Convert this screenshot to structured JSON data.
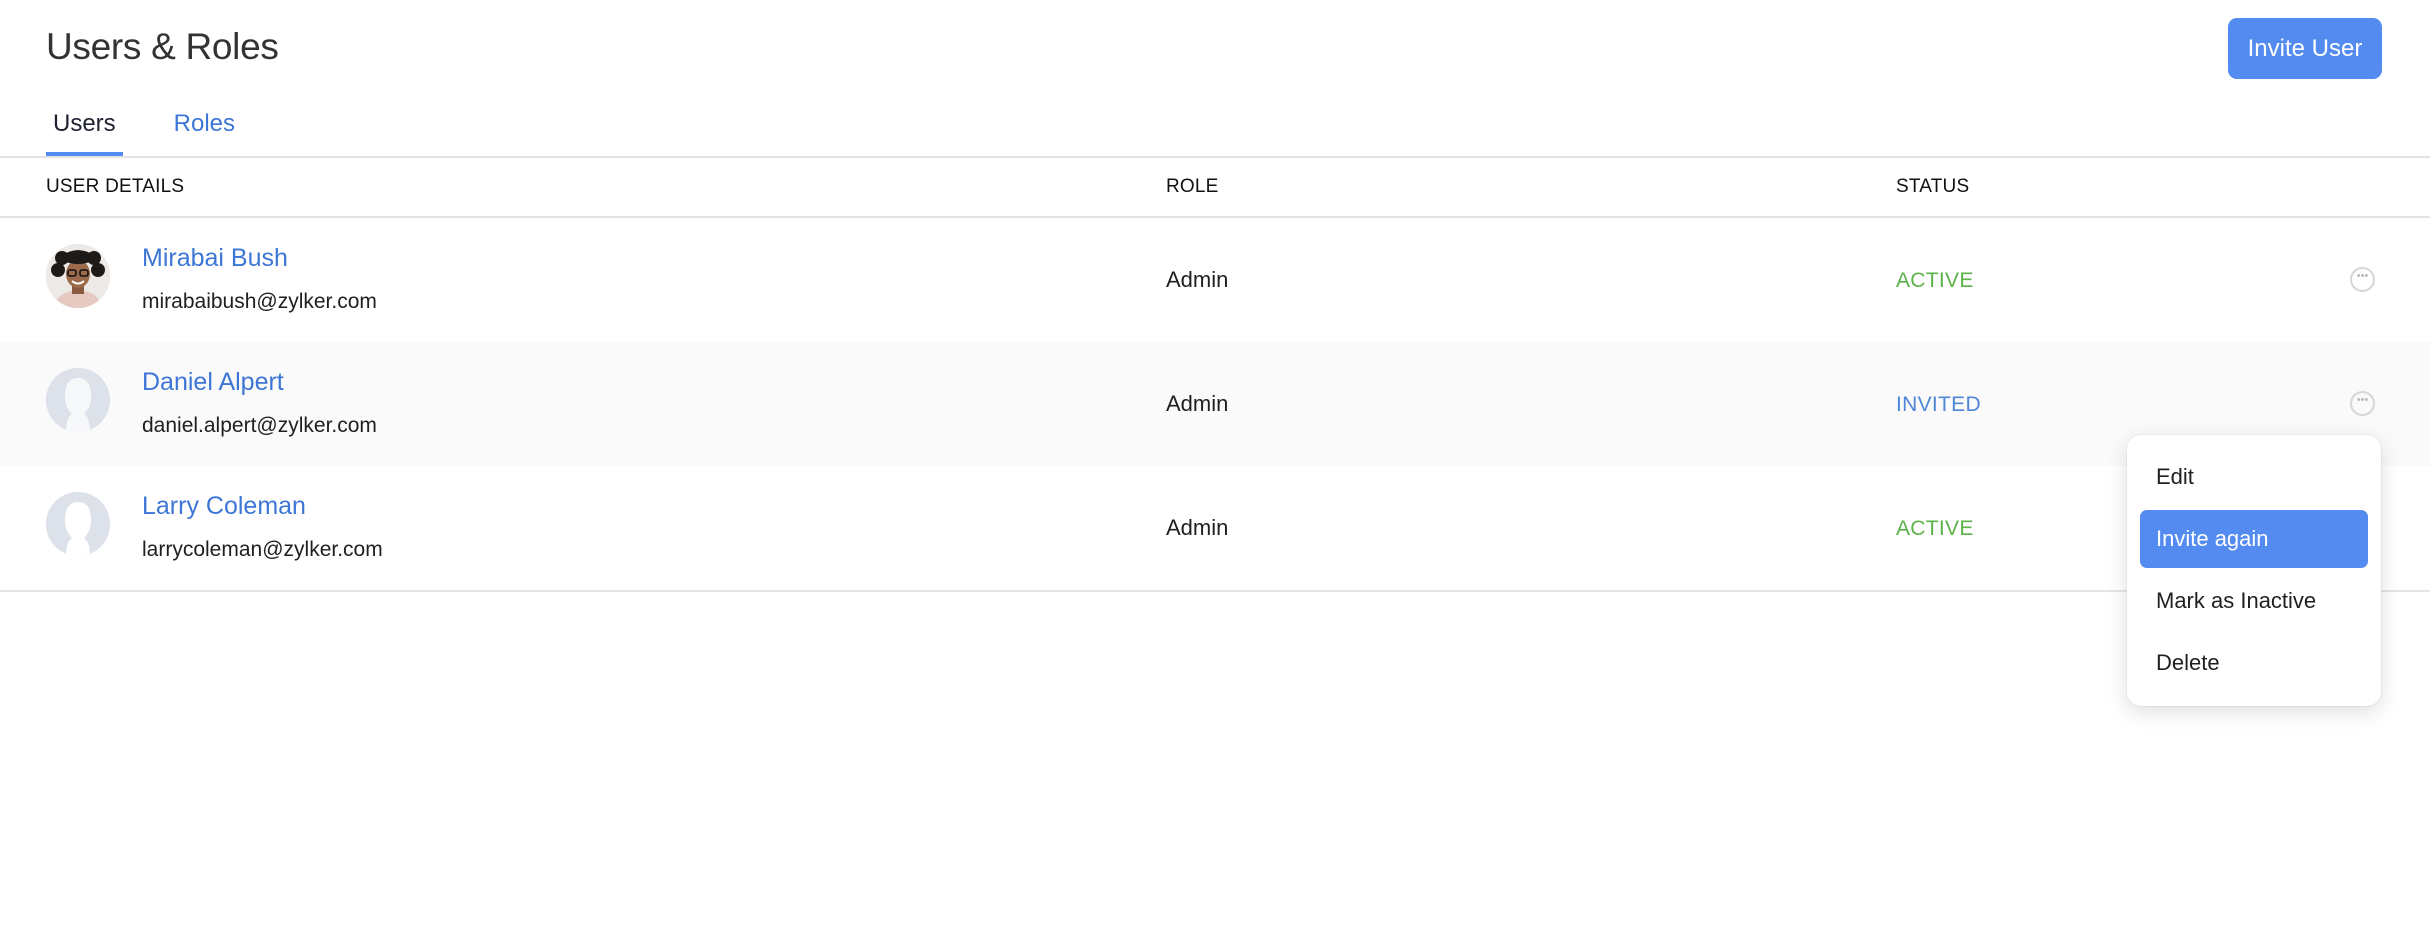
{
  "header": {
    "title": "Users & Roles",
    "invite_button": "Invite User"
  },
  "tabs": [
    {
      "label": "Users",
      "active": true
    },
    {
      "label": "Roles",
      "active": false
    }
  ],
  "table": {
    "columns": [
      "USER DETAILS",
      "ROLE",
      "STATUS"
    ],
    "rows": [
      {
        "name": "Mirabai Bush",
        "email": "mirabaibush@zylker.com",
        "role": "Admin",
        "status": "ACTIVE",
        "avatar": "photo"
      },
      {
        "name": "Daniel Alpert",
        "email": "daniel.alpert@zylker.com",
        "role": "Admin",
        "status": "INVITED",
        "avatar": "placeholder"
      },
      {
        "name": "Larry Coleman",
        "email": "larrycoleman@zylker.com",
        "role": "Admin",
        "status": "ACTIVE",
        "avatar": "placeholder"
      }
    ]
  },
  "row_menu": {
    "open_for_row": 1,
    "items": [
      {
        "label": "Edit",
        "highlighted": false
      },
      {
        "label": "Invite again",
        "highlighted": true
      },
      {
        "label": "Mark as Inactive",
        "highlighted": false
      },
      {
        "label": "Delete",
        "highlighted": false
      }
    ]
  },
  "colors": {
    "accent": "#548bf0",
    "link": "#3d76d6",
    "status_active": "#5bb14a",
    "status_invited": "#4f86d6"
  },
  "icons": {
    "more": "more-horizontal-circle-icon",
    "avatar_placeholder": "user-silhouette-icon"
  }
}
